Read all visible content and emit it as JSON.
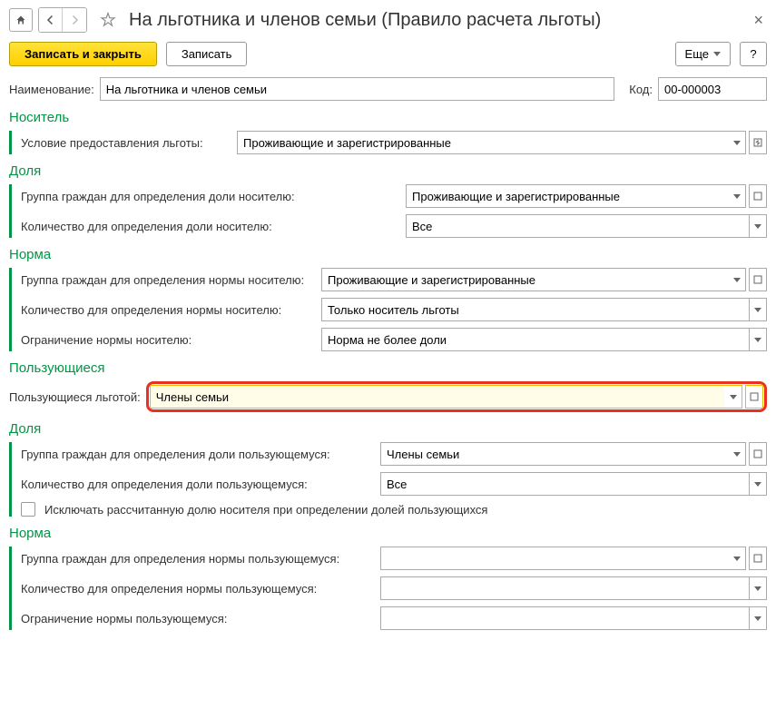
{
  "title": "На льготника и членов семьи (Правило расчета льготы)",
  "buttons": {
    "save_close": "Записать и закрыть",
    "save": "Записать",
    "more": "Еще",
    "help": "?"
  },
  "fields": {
    "name_label": "Наименование:",
    "name_value": "На льготника и членов семьи",
    "code_label": "Код:",
    "code_value": "00-000003"
  },
  "sections": {
    "carrier": {
      "title": "Носитель",
      "condition_label": "Условие предоставления льготы:",
      "condition_value": "Проживающие и зарегистрированные"
    },
    "share": {
      "title": "Доля",
      "group_label": "Группа граждан для определения доли носителю:",
      "group_value": "Проживающие и зарегистрированные",
      "count_label": "Количество для определения доли носителю:",
      "count_value": "Все"
    },
    "norm": {
      "title": "Норма",
      "group_label": "Группа граждан для определения нормы носителю:",
      "group_value": "Проживающие и зарегистрированные",
      "count_label": "Количество для определения нормы носителю:",
      "count_value": "Только носитель льготы",
      "limit_label": "Ограничение нормы носителю:",
      "limit_value": "Норма не более доли"
    },
    "users": {
      "title": "Пользующиеся",
      "benefit_label": "Пользующиеся льготой:",
      "benefit_value": "Члены семьи"
    },
    "users_share": {
      "title": "Доля",
      "group_label": "Группа граждан для определения доли пользующемуся:",
      "group_value": "Члены семьи",
      "count_label": "Количество для определения доли пользующемуся:",
      "count_value": "Все",
      "exclude_label": "Исключать рассчитанную долю носителя при определении долей пользующихся"
    },
    "users_norm": {
      "title": "Норма",
      "group_label": "Группа граждан для определения нормы пользующемуся:",
      "group_value": "",
      "count_label": "Количество для определения нормы пользующемуся:",
      "count_value": "",
      "limit_label": "Ограничение нормы пользующемуся:",
      "limit_value": ""
    }
  }
}
